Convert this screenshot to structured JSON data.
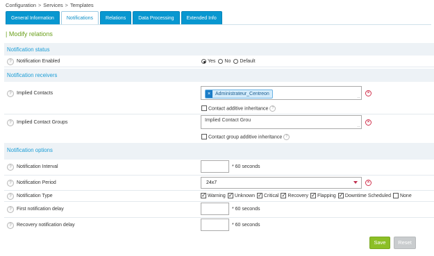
{
  "breadcrumb": {
    "items": [
      "Configuration",
      "Services",
      "Templates"
    ],
    "separator": ">"
  },
  "tabs": [
    {
      "label": "General Information",
      "active": false
    },
    {
      "label": "Notifications",
      "active": true
    },
    {
      "label": "Relations",
      "active": false
    },
    {
      "label": "Data Processing",
      "active": false
    },
    {
      "label": "Extended Info",
      "active": false
    }
  ],
  "page_title": "| Modify relations",
  "sections": {
    "status": "Notification status",
    "receivers": "Notification receivers",
    "options": "Notification options"
  },
  "notification_enabled": {
    "label": "Notification Enabled",
    "options": [
      "Yes",
      "No",
      "Default"
    ],
    "selected": "Yes"
  },
  "implied_contacts": {
    "label": "Implied Contacts",
    "selected": [
      "Administrateur_Centreon"
    ],
    "chip_remove": "×"
  },
  "contact_additive": {
    "label": "Contact additive inheritance",
    "checked": false
  },
  "implied_contact_groups": {
    "label": "Implied Contact Groups",
    "placeholder": "Implied Contact Grou"
  },
  "group_additive": {
    "label": "Contact group additive inheritance",
    "checked": false
  },
  "notification_interval": {
    "label": "Notification Interval",
    "value": "",
    "unit": "* 60 seconds"
  },
  "notification_period": {
    "label": "Notification Period",
    "value": "24x7"
  },
  "notification_type": {
    "label": "Notification Type",
    "options": [
      {
        "label": "Warning",
        "checked": true
      },
      {
        "label": "Unknown",
        "checked": true
      },
      {
        "label": "Critical",
        "checked": true
      },
      {
        "label": "Recovery",
        "checked": true
      },
      {
        "label": "Flapping",
        "checked": true
      },
      {
        "label": "Downtime Scheduled",
        "checked": true
      },
      {
        "label": "None",
        "checked": false
      }
    ]
  },
  "first_notification_delay": {
    "label": "First notification delay",
    "value": "",
    "unit": "* 60 seconds"
  },
  "recovery_notification_delay": {
    "label": "Recovery notification delay",
    "value": "",
    "unit": "* 60 seconds"
  },
  "buttons": {
    "save": "Save",
    "reset": "Reset"
  },
  "icons": {
    "help": "?",
    "grip": "..",
    "clear": "×"
  },
  "colors": {
    "accent": "#0897d0",
    "title_green": "#6aa01b",
    "save": "#8cbf26",
    "clear_red": "#d0314d"
  }
}
